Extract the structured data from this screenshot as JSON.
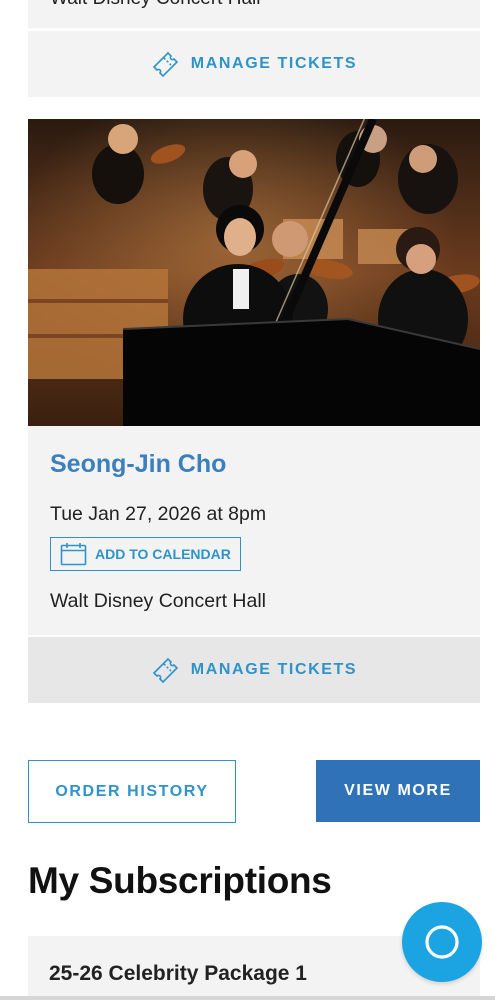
{
  "prev_event": {
    "venue": "Walt Disney Concert Hall",
    "manage_label": "MANAGE TICKETS"
  },
  "event": {
    "image_alt": "Pianist performing with orchestra",
    "title": "Seong-Jin Cho",
    "date": "Tue Jan 27, 2026 at 8pm",
    "calendar_label": "ADD TO CALENDAR",
    "venue": "Walt Disney Concert Hall",
    "manage_label": "MANAGE TICKETS"
  },
  "actions": {
    "order_history": "ORDER HISTORY",
    "view_more": "VIEW MORE"
  },
  "subscriptions": {
    "heading": "My Subscriptions",
    "items": [
      {
        "name": "25-26 Celebrity Package 1"
      }
    ]
  },
  "colors": {
    "accent": "#2e93c9",
    "title_blue": "#3b7fbd",
    "primary_button": "#2f72b7",
    "help_button": "#1ca4e2",
    "card_bg": "#f3f3f3"
  },
  "icons": {
    "ticket": "ticket-icon",
    "calendar": "calendar-icon",
    "help": "help-chat-icon"
  }
}
